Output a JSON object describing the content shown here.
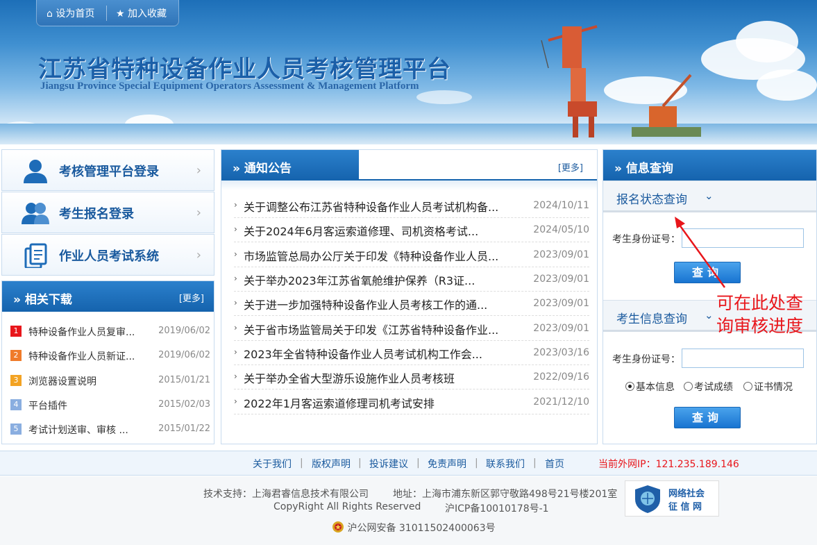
{
  "topbar": {
    "home_label": "设为首页",
    "fav_label": "加入收藏"
  },
  "site": {
    "title": "江苏省特种设备作业人员考核管理平台",
    "subtitle": "Jiangsu Province Special Equipment Operators Assessment & Management Platform"
  },
  "login": [
    {
      "label": "考核管理平台登录",
      "icon": "person-icon"
    },
    {
      "label": "考生报名登录",
      "icon": "people-icon"
    },
    {
      "label": "作业人员考试系统",
      "icon": "document-icon"
    }
  ],
  "downloads": {
    "title": "相关下载",
    "more": "[更多]",
    "items": [
      {
        "num": "1",
        "color": "#e8161b",
        "text": "特种设备作业人员复审...",
        "date": "2019/06/02"
      },
      {
        "num": "2",
        "color": "#f07b2a",
        "text": "特种设备作业人员新证...",
        "date": "2019/06/02"
      },
      {
        "num": "3",
        "color": "#f3a323",
        "text": "浏览器设置说明",
        "date": "2015/01/21"
      },
      {
        "num": "4",
        "color": "#8aaee0",
        "text": "平台插件",
        "date": "2015/02/03"
      },
      {
        "num": "5",
        "color": "#8aaee0",
        "text": "考试计划送审、审核 ...",
        "date": "2015/01/22"
      }
    ]
  },
  "notice": {
    "title": "通知公告",
    "more": "[更多]",
    "items": [
      {
        "text": "关于调整公布江苏省特种设备作业人员考试机构备...",
        "date": "2024/10/11"
      },
      {
        "text": "关于2024年6月客运索道修理、司机资格考试...",
        "date": "2024/05/10"
      },
      {
        "text": "市场监管总局办公厅关于印发《特种设备作业人员...",
        "date": "2023/09/01"
      },
      {
        "text": "关于举办2023年江苏省氧舱维护保养（R3证...",
        "date": "2023/09/01"
      },
      {
        "text": "关于进一步加强特种设备作业人员考核工作的通...",
        "date": "2023/09/01"
      },
      {
        "text": "关于省市场监管局关于印发《江苏省特种设备作业...",
        "date": "2023/09/01"
      },
      {
        "text": "2023年全省特种设备作业人员考试机构工作会...",
        "date": "2023/03/16"
      },
      {
        "text": "关于举办全省大型游乐设施作业人员考核班",
        "date": "2022/09/16"
      },
      {
        "text": "2022年1月客运索道修理司机考试安排",
        "date": "2021/12/10"
      }
    ]
  },
  "query": {
    "title": "信息查询",
    "status_title": "报名状态查询",
    "info_title": "考生信息查询",
    "id_label": "考生身份证号：",
    "id_value_1": "",
    "id_value_2": "",
    "button": "查询",
    "radios": [
      "基本信息",
      "考试成绩",
      "证书情况"
    ],
    "selected_radio": "基本信息"
  },
  "annotation": {
    "line1": "可在此处查",
    "line2": "询审核进度",
    "color": "#e8161b"
  },
  "footer": {
    "links": [
      "关于我们",
      "版权声明",
      "投诉建议",
      "免责声明",
      "联系我们",
      "首页"
    ],
    "ip_label": "当前外网IP：121.235.189.146",
    "tech": "技术支持：上海君睿信息技术有限公司",
    "address": "地址：上海市浦东新区郭守敬路498号21号楼201室",
    "copyright": "CopyRight All Rights Reserved",
    "icp": "沪ICP备10010178号-1",
    "police": "沪公网安备 31011502400063号",
    "badge_line1": "网络社会",
    "badge_line2": "征 信 网"
  }
}
